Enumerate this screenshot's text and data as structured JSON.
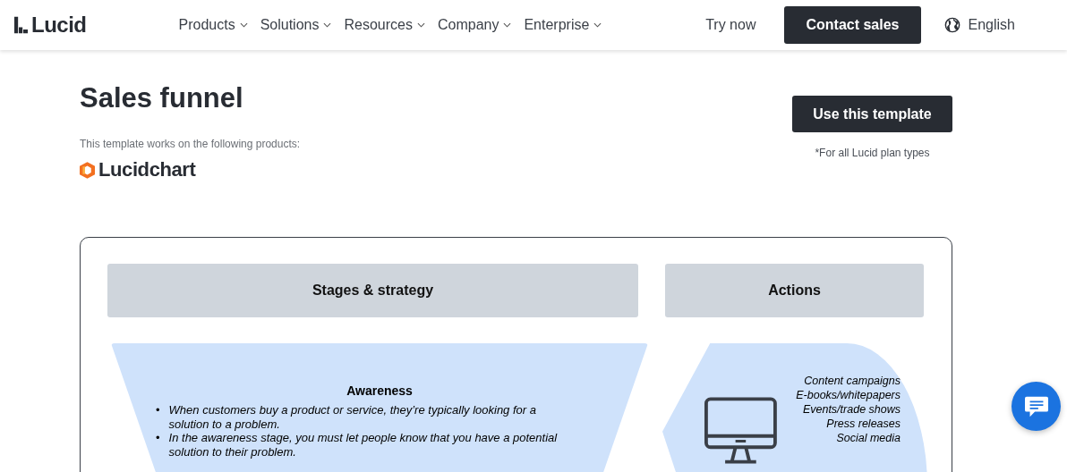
{
  "header": {
    "logo": "Lucid",
    "nav": [
      {
        "label": "Products",
        "dropdown": true
      },
      {
        "label": "Solutions",
        "dropdown": true
      },
      {
        "label": "Resources",
        "dropdown": true
      },
      {
        "label": "Company",
        "dropdown": true
      },
      {
        "label": "Enterprise",
        "dropdown": true
      }
    ],
    "try_now": "Try now",
    "contact_sales": "Contact sales",
    "language": "English"
  },
  "page": {
    "title": "Sales funnel",
    "products_note": "This template works on the following products:",
    "product": "Lucidchart",
    "use_template": "Use this template",
    "plan_note": "*For all Lucid plan types"
  },
  "preview": {
    "columns": [
      "Stages & strategy",
      "Actions"
    ],
    "stage": {
      "title": "Awareness",
      "marker": "•",
      "bullets": [
        "When customers buy a product or service, they’re typically looking for a solution to a problem.",
        "In the awareness stage, you must let people know that you have a potential solution to their problem."
      ]
    },
    "actions": [
      "Content campaigns",
      "E-books/whitepapers",
      "Events/trade shows",
      "Press releases",
      "Social media"
    ]
  }
}
